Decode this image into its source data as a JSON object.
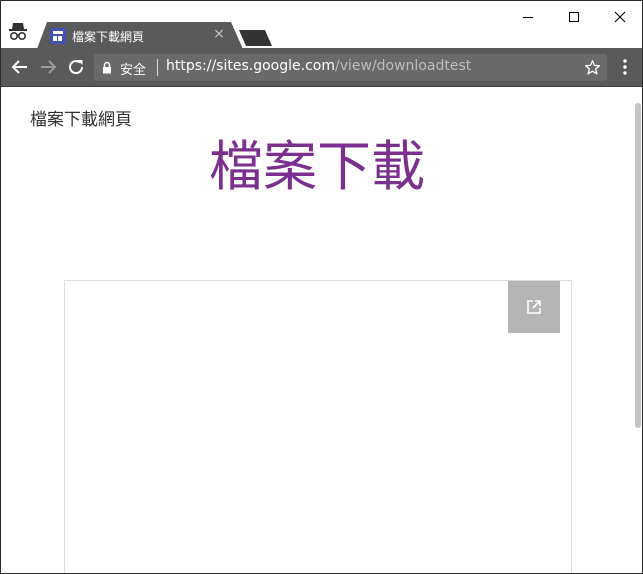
{
  "browser": {
    "tab": {
      "title": "檔案下載網頁",
      "close_symbol": "×"
    },
    "omnibox": {
      "security_label": "安全",
      "url_scheme_host": "https://sites.google.com",
      "url_path": "/view/downloadtest"
    },
    "icons": {
      "incognito": "incognito-icon",
      "back": "back-arrow-icon",
      "forward": "forward-arrow-icon",
      "reload": "reload-icon",
      "lock": "lock-icon",
      "star": "star-icon",
      "menu": "vertical-dots-icon",
      "popout": "open-in-new-icon"
    },
    "colors": {
      "toolbar": "#5a5a5a",
      "tab_active": "#5a5a5a",
      "heading": "#7b2f8e",
      "favicon": "#3f51b5"
    }
  },
  "page": {
    "site_title": "檔案下載網頁",
    "heading": "檔案下載"
  }
}
